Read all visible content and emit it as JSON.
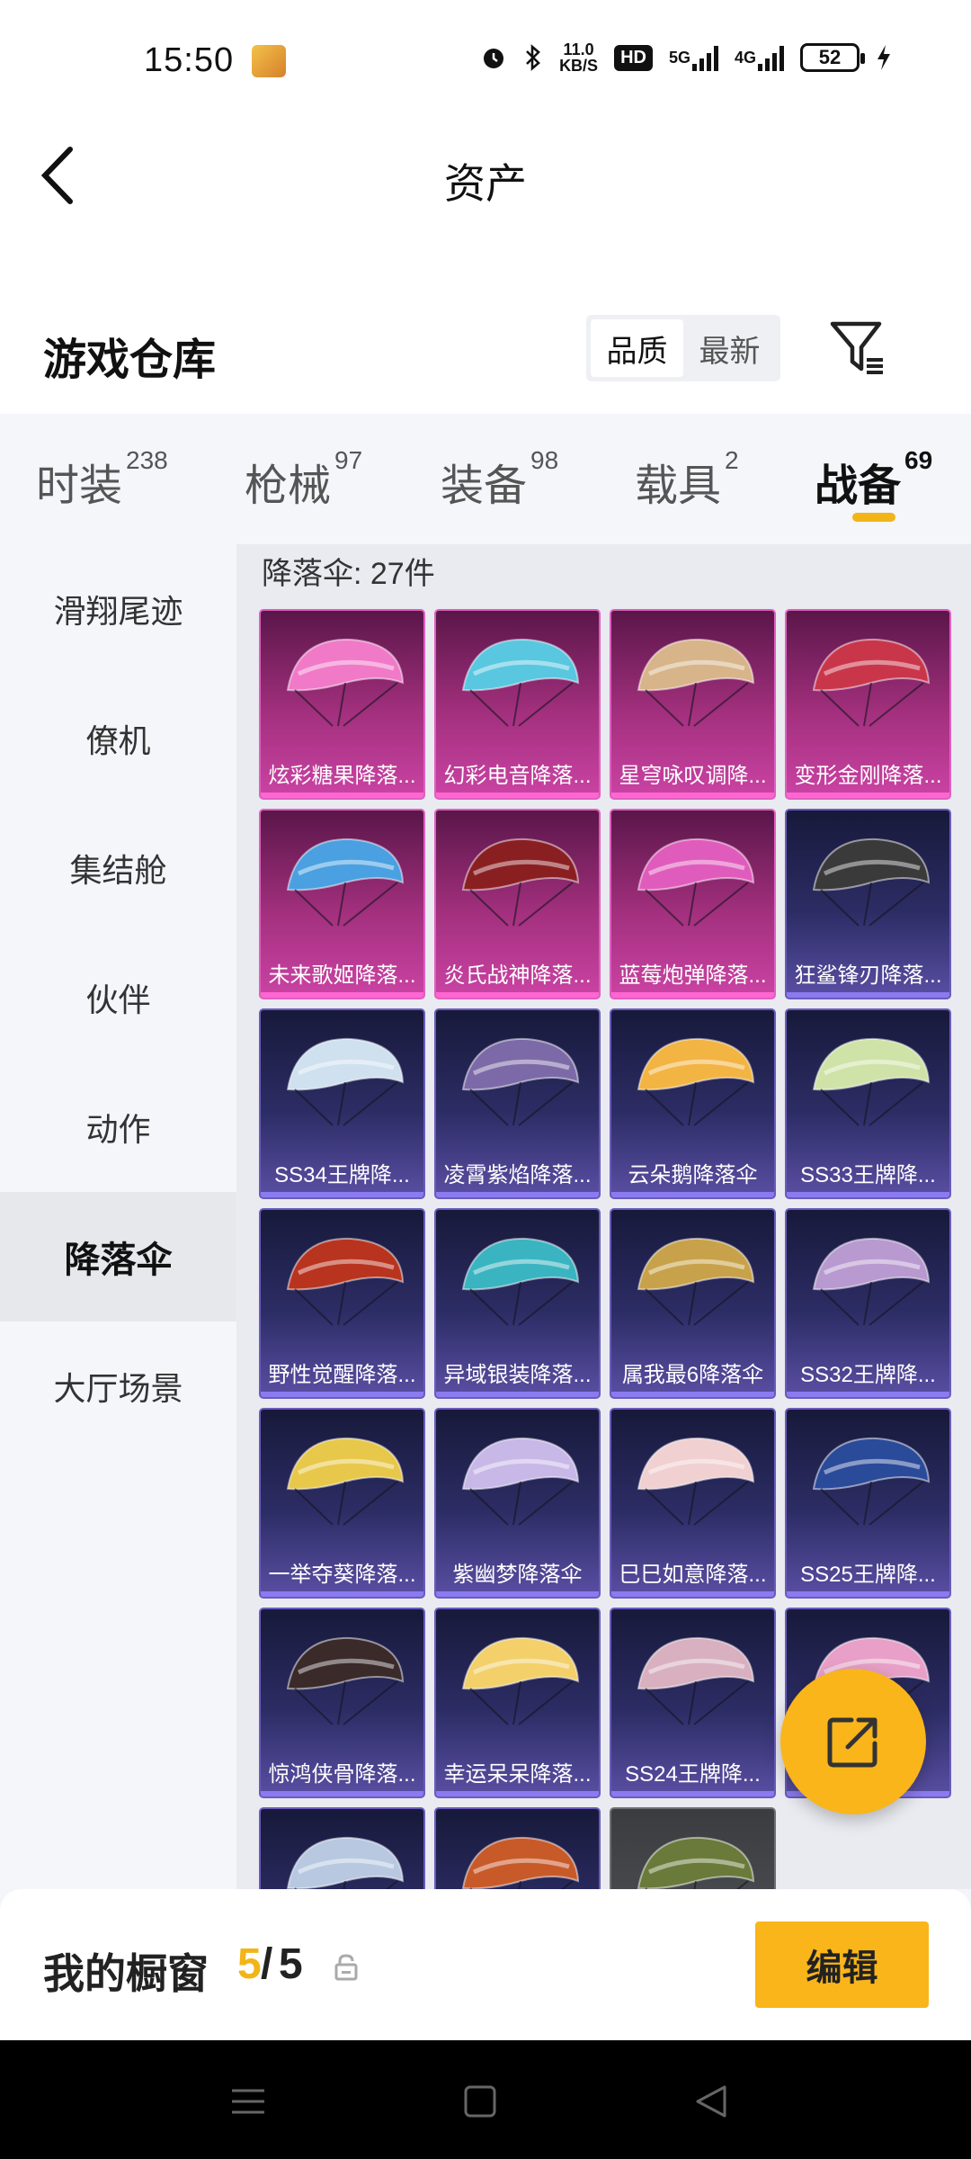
{
  "status_bar": {
    "time": "15:50",
    "net_speed_value": "11.0",
    "net_speed_unit": "KB/S",
    "hd_label": "HD",
    "net1": "5G",
    "net2": "4G",
    "battery": "52"
  },
  "header": {
    "title": "资产"
  },
  "warehouse": {
    "title": "游戏仓库",
    "sort_options": [
      "品质",
      "最新"
    ],
    "active_sort": "品质"
  },
  "tabs": [
    {
      "label": "时装",
      "count": "238"
    },
    {
      "label": "枪械",
      "count": "97"
    },
    {
      "label": "装备",
      "count": "98"
    },
    {
      "label": "载具",
      "count": "2"
    },
    {
      "label": "战备",
      "count": "69"
    }
  ],
  "active_tab": "战备",
  "sidebar": {
    "items": [
      "滑翔尾迹",
      "僚机",
      "集结舱",
      "伙伴",
      "动作",
      "降落伞",
      "大厅场景"
    ],
    "active": "降落伞"
  },
  "content": {
    "count_label": "降落伞: 27件",
    "items": [
      {
        "name": "炫彩糖果降落...",
        "tier": "pink",
        "color": "#f07ac8"
      },
      {
        "name": "幻彩电音降落...",
        "tier": "pink",
        "color": "#59c7e0"
      },
      {
        "name": "星穹咏叹调降...",
        "tier": "pink",
        "color": "#d8b48a"
      },
      {
        "name": "变形金刚降落...",
        "tier": "pink",
        "color": "#c9364a"
      },
      {
        "name": "未来歌姬降落...",
        "tier": "pink",
        "color": "#4aa0e0"
      },
      {
        "name": "炎氏战神降落...",
        "tier": "pink",
        "color": "#8a1f22"
      },
      {
        "name": "蓝莓炮弹降落...",
        "tier": "pink",
        "color": "#e05cbc"
      },
      {
        "name": "狂鲨锋刃降落...",
        "tier": "blue",
        "color": "#3a3a3a"
      },
      {
        "name": "SS34王牌降...",
        "tier": "blue",
        "color": "#cfe0ef"
      },
      {
        "name": "凌霄紫焰降落...",
        "tier": "blue",
        "color": "#7c6aa8"
      },
      {
        "name": "云朵鹅降落伞",
        "tier": "blue",
        "color": "#f2b443"
      },
      {
        "name": "SS33王牌降...",
        "tier": "blue",
        "color": "#cfe3a8"
      },
      {
        "name": "野性觉醒降落...",
        "tier": "blue",
        "color": "#b8341f"
      },
      {
        "name": "异域银装降落...",
        "tier": "blue",
        "color": "#3ab4c0"
      },
      {
        "name": "属我最6降落伞",
        "tier": "blue",
        "color": "#c8a24a"
      },
      {
        "name": "SS32王牌降...",
        "tier": "blue",
        "color": "#b89ad0"
      },
      {
        "name": "一举夺葵降落...",
        "tier": "blue",
        "color": "#e8c84a"
      },
      {
        "name": "紫幽梦降落伞",
        "tier": "blue",
        "color": "#c8b8e8"
      },
      {
        "name": "巳巳如意降落...",
        "tier": "blue",
        "color": "#f0d0d0"
      },
      {
        "name": "SS25王牌降...",
        "tier": "blue",
        "color": "#2a4a9a"
      },
      {
        "name": "惊鸿侠骨降落...",
        "tier": "blue",
        "color": "#3a2a2a"
      },
      {
        "name": "幸运呆呆降落...",
        "tier": "blue",
        "color": "#f3d06a"
      },
      {
        "name": "SS24王牌降...",
        "tier": "blue",
        "color": "#d8b0c0"
      },
      {
        "name": "",
        "tier": "blue",
        "color": "#e8a0c8"
      },
      {
        "name": "",
        "tier": "blue",
        "color": "#b8c8e0"
      },
      {
        "name": "",
        "tier": "blue",
        "color": "#c85a2a"
      },
      {
        "name": "",
        "tier": "grey",
        "color": "#6a7a3a"
      }
    ]
  },
  "showcase": {
    "label": "我的橱窗",
    "current": "5",
    "separator": "/",
    "total": "5",
    "edit_label": "编辑"
  }
}
